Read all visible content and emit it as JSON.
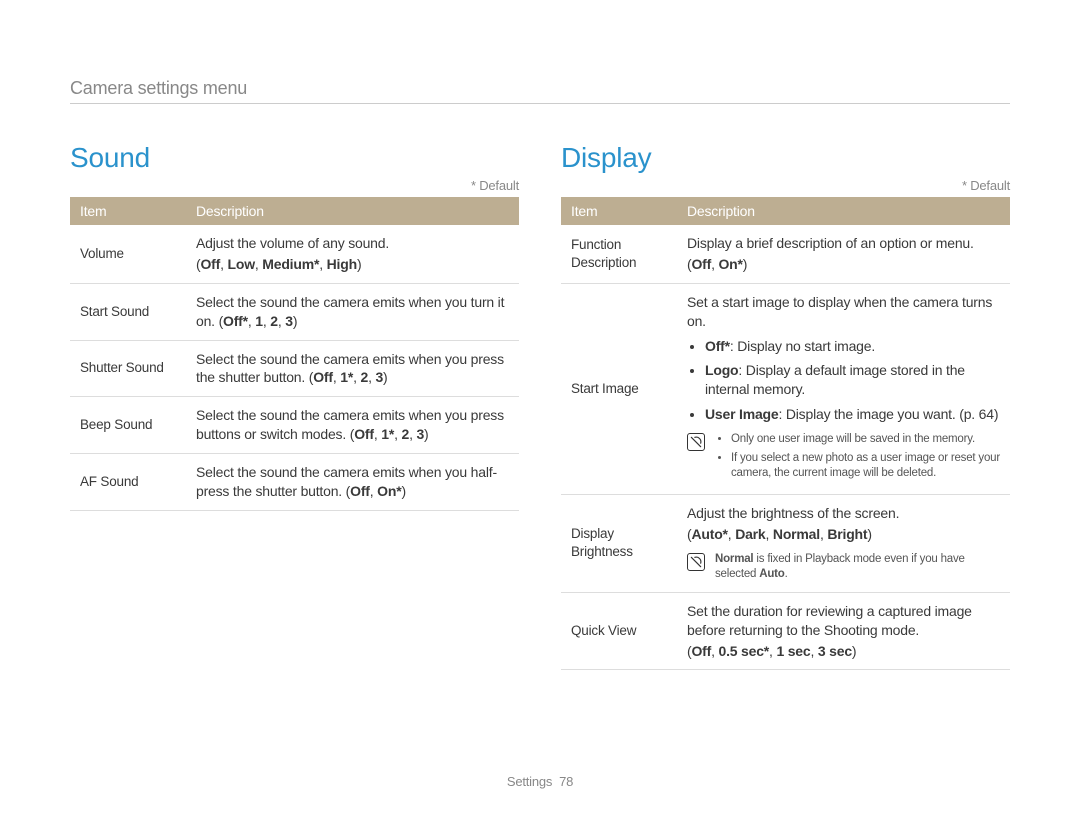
{
  "breadcrumb": "Camera settings menu",
  "default_label": "* Default",
  "thead": {
    "item": "Item",
    "desc": "Description"
  },
  "sound": {
    "title": "Sound",
    "rows": [
      {
        "item": "Volume",
        "desc": "Adjust the volume of any sound.",
        "options": "(Off, Low, Medium*, High)"
      },
      {
        "item": "Start Sound",
        "desc": "Select the sound the camera emits when you turn it on.",
        "options_inline": " (Off*, 1, 2, 3)"
      },
      {
        "item": "Shutter Sound",
        "desc": "Select the sound the camera emits when you press the shutter button.",
        "options_inline": " (Off, 1*, 2, 3)"
      },
      {
        "item": "Beep Sound",
        "desc": "Select the sound the camera emits when you press buttons or switch modes.",
        "options_inline": " (Off, 1*, 2, 3)"
      },
      {
        "item": "AF Sound",
        "desc": "Select the sound the camera emits when you half-press the shutter button.",
        "options_inline": " (Off, On*)"
      }
    ]
  },
  "display": {
    "title": "Display",
    "rows": {
      "func_desc": {
        "item": "Function Description",
        "desc": "Display a brief description of an option or menu.",
        "options": "(Off, On*)"
      },
      "start_image": {
        "item": "Start Image",
        "desc": "Set a start image to display when the camera turns on.",
        "bullets": [
          {
            "bold": "Off*",
            "text": ": Display no start image."
          },
          {
            "bold": "Logo",
            "text": ": Display a default image stored in the internal memory."
          },
          {
            "bold": "User Image",
            "text": ": Display the image you want. (p. 64)"
          }
        ],
        "notes": [
          "Only one user image will be saved in the memory.",
          "If you select a new photo as a user image or reset your camera, the current image will be deleted."
        ]
      },
      "brightness": {
        "item": "Display Brightness",
        "desc": "Adjust the brightness of the screen.",
        "options": "(Auto*, Dark, Normal, Bright)",
        "note_bold1": "Normal",
        "note_mid": " is fixed in Playback mode even if you have selected ",
        "note_bold2": "Auto",
        "note_tail": "."
      },
      "quick_view": {
        "item": "Quick View",
        "desc": "Set the duration for reviewing a captured image before returning to the Shooting mode.",
        "options": "(Off, 0.5 sec*, 1 sec, 3 sec)"
      }
    }
  },
  "footer": {
    "section": "Settings",
    "page": "78"
  }
}
